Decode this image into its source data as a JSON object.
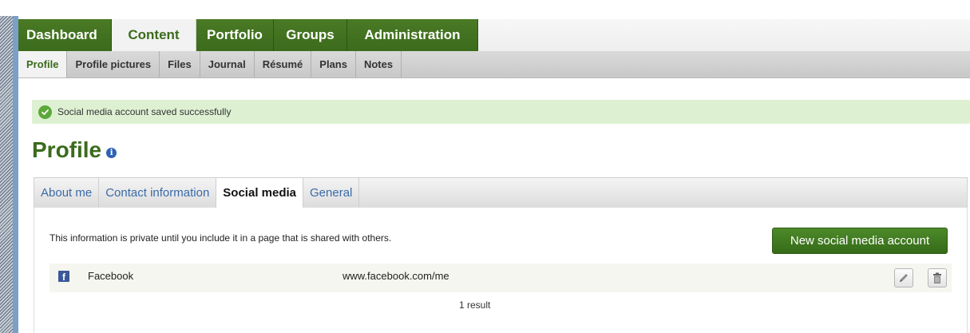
{
  "main_nav": {
    "items": [
      {
        "label": "Dashboard"
      },
      {
        "label": "Content"
      },
      {
        "label": "Portfolio"
      },
      {
        "label": "Groups"
      },
      {
        "label": "Administration"
      }
    ],
    "active": "Content"
  },
  "sub_nav": {
    "items": [
      {
        "label": "Profile"
      },
      {
        "label": "Profile pictures"
      },
      {
        "label": "Files"
      },
      {
        "label": "Journal"
      },
      {
        "label": "Résumé"
      },
      {
        "label": "Plans"
      },
      {
        "label": "Notes"
      }
    ],
    "active": "Profile"
  },
  "message": {
    "text": "Social media account saved successfully",
    "icon": "check-circle-icon"
  },
  "page": {
    "title": "Profile",
    "info_icon": "info-icon"
  },
  "profile_tabs": {
    "items": [
      {
        "label": "About me"
      },
      {
        "label": "Contact information"
      },
      {
        "label": "Social media"
      },
      {
        "label": "General"
      }
    ],
    "active": "Social media"
  },
  "panel": {
    "description": "This information is private until you include it in a page that is shared with others.",
    "new_button": "New social media account",
    "accounts": [
      {
        "icon": "facebook-icon",
        "name": "Facebook",
        "url": "www.facebook.com/me"
      }
    ],
    "result_count": "1 result"
  },
  "colors": {
    "brand_green": "#3b6b1c",
    "success_bg": "#ddf1d2",
    "link_blue": "#3a6aa8",
    "facebook_blue": "#3b5998"
  }
}
